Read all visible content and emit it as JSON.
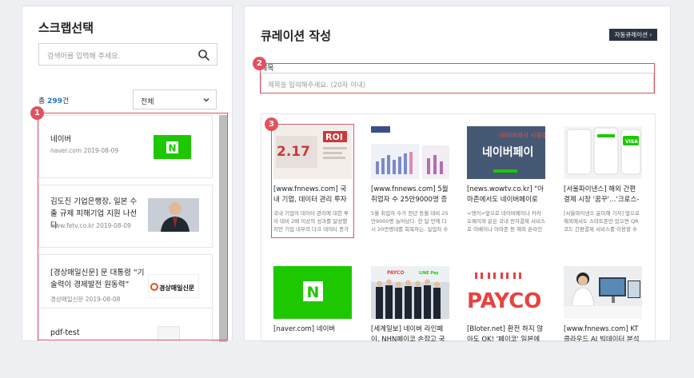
{
  "left": {
    "title": "스크랩선택",
    "search_placeholder": "검색어를 입력해 주세요.",
    "count_prefix": "총 ",
    "count_num": "299",
    "count_suffix": "건",
    "filter_value": "전체",
    "items": [
      {
        "title": "네이버",
        "meta": "naver.com 2019-08-09",
        "thumb": "naver-logo"
      },
      {
        "title": "김도진 기업은행장, 일본 수출 규제 피해기업 지원 나선다",
        "meta": "www.fetv.co.kr 2019-08-09",
        "thumb": "person-photo"
      },
      {
        "title": "[경상매일신문] 문 대통령 “기술력이 경제발전 원동력”",
        "meta": "경상매일신문 2019-08-08",
        "thumb": "newspaper-logo",
        "thumb_text": "경상매일신문"
      },
      {
        "title": "pdf-test",
        "meta": "",
        "thumb": "document"
      }
    ]
  },
  "right": {
    "title": "큐레이션 작성",
    "auto_button": "자동큐레이션 ›",
    "title_label": "제목",
    "title_placeholder": "제목을 입력해주세요. (20자 이내)",
    "grid": [
      {
        "title": "[www.fnnews.com] 국내 기업, 데이터 관리 투자",
        "desc": "국내 기업이 데이터 관리에 대한 투자 대비 2배 이상의 성과를 달성했지만 기업 내부의 다크 데이터 증가로",
        "img": "roi"
      },
      {
        "title": "[www.fnnews.com] 5월 취업자 수 25만9000명 증",
        "desc": "5월 취업자 수가 전년 동월 대비 25만9000명 늘어났다. 한 달 만에 다시 20만명대를 회복하는. 실업자 수",
        "img": "chart"
      },
      {
        "title": "[news.wowtv.co.kr] \"아마존에서도 네이버페이로",
        "desc": "<앵커>앞으로 네이버페이나 카카오페이와 같은 국내 전자결제 서비스로 이베이나 아마존 등 해외 온라인 쇼",
        "img": "naverpay"
      },
      {
        "title": "[서울파이낸스] 해외 간편결제 시장 '꿈꾸'…'크로스-",
        "desc": "[서울파이낸스 윤미혜 기자] 앞으로 해외에서도 스마트폰만 있으면 QR코드 간편결제 서비스를 이용할 수",
        "img": "phones"
      },
      {
        "title": "[naver.com] 네이버",
        "desc": "",
        "img": "naver"
      },
      {
        "title": "[세계일보] 네이버 라인페이, NHN페이코 손잡고 국내",
        "desc": "",
        "img": "people"
      },
      {
        "title": "[Bloter.net] 환전 하지 않아도 OK! '페이코' 일본에서",
        "desc": "",
        "img": "payco"
      },
      {
        "title": "[www.fnnews.com] KT 클라우드 AI 빅데이터 분석",
        "desc": "",
        "img": "woman"
      }
    ],
    "img_text": {
      "roi": "ROI",
      "roi_num": "2.17",
      "naverpay": "네이버페이",
      "naverpay_top": "네이버에서 사용할 땐",
      "payco": "PAYCO",
      "payco_small": "PAYCO",
      "payco_green": "LINE Pay",
      "visa": "VISA",
      "naver_n": "N"
    }
  },
  "annotations": [
    "1",
    "2",
    "3"
  ],
  "colors": {
    "naver_green": "#1ec800",
    "payco_red": "#e8423f",
    "highlight": "#e0525f",
    "link_blue": "#1e78d3"
  }
}
